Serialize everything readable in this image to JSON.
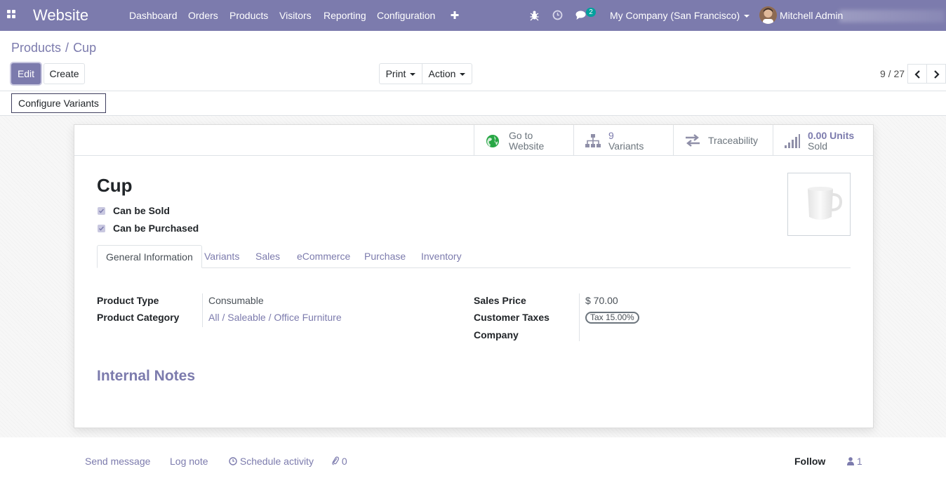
{
  "navbar": {
    "brand": "Website",
    "menus": [
      "Dashboard",
      "Orders",
      "Products",
      "Visitors",
      "Reporting",
      "Configuration"
    ],
    "messages_count": "2",
    "company": "My Company (San Francisco)",
    "user": "Mitchell Admin"
  },
  "breadcrumb": {
    "parent": "Products",
    "separator": "/",
    "current": "Cup"
  },
  "buttons": {
    "edit": "Edit",
    "create": "Create",
    "print": "Print",
    "action": "Action",
    "configure_variants": "Configure Variants"
  },
  "pager": {
    "value": "9 / 27"
  },
  "smart_buttons": {
    "website_line1": "Go to",
    "website_line2": "Website",
    "variants_count": "9",
    "variants_label": "Variants",
    "traceability": "Traceability",
    "sold_value": "0.00 Units",
    "sold_label": "Sold"
  },
  "product": {
    "name": "Cup",
    "can_be_sold": "Can be Sold",
    "can_be_purchased": "Can be Purchased"
  },
  "tabs": [
    "General Information",
    "Variants",
    "Sales",
    "eCommerce",
    "Purchase",
    "Inventory"
  ],
  "fields": {
    "product_type_label": "Product Type",
    "product_type_value": "Consumable",
    "product_category_label": "Product Category",
    "product_category_value": "All / Saleable / Office Furniture",
    "sales_price_label": "Sales Price",
    "sales_price_value": "$ 70.00",
    "customer_taxes_label": "Customer Taxes",
    "customer_taxes_tag": "Tax 15.00%",
    "company_label": "Company"
  },
  "notes": {
    "title": "Internal Notes"
  },
  "chatter": {
    "send_message": "Send message",
    "log_note": "Log note",
    "schedule_activity": "Schedule activity",
    "attachments_count": "0",
    "follow": "Follow",
    "followers_count": "1"
  },
  "colors": {
    "brand": "#7c7bad",
    "accent": "#00a09d"
  }
}
